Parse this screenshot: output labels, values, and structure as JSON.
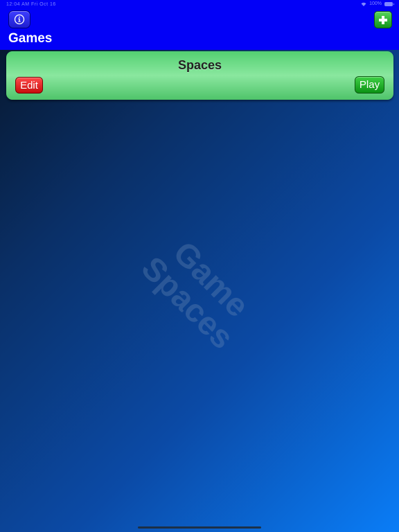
{
  "status_bar": {
    "time_date": "12:04 AM   Fri Oct 16",
    "battery": "100%"
  },
  "header": {
    "title": "Games",
    "info_icon": "info-circle-icon",
    "add_icon": "plus-icon"
  },
  "games": [
    {
      "name": "Spaces",
      "edit_label": "Edit",
      "play_label": "Play"
    }
  ],
  "watermark": {
    "line1": "Game",
    "line2": "Spaces"
  },
  "colors": {
    "header_bg": "#0200f7",
    "card_green": "#6fdc86",
    "edit_red": "#e02020",
    "play_green": "#18a522"
  }
}
